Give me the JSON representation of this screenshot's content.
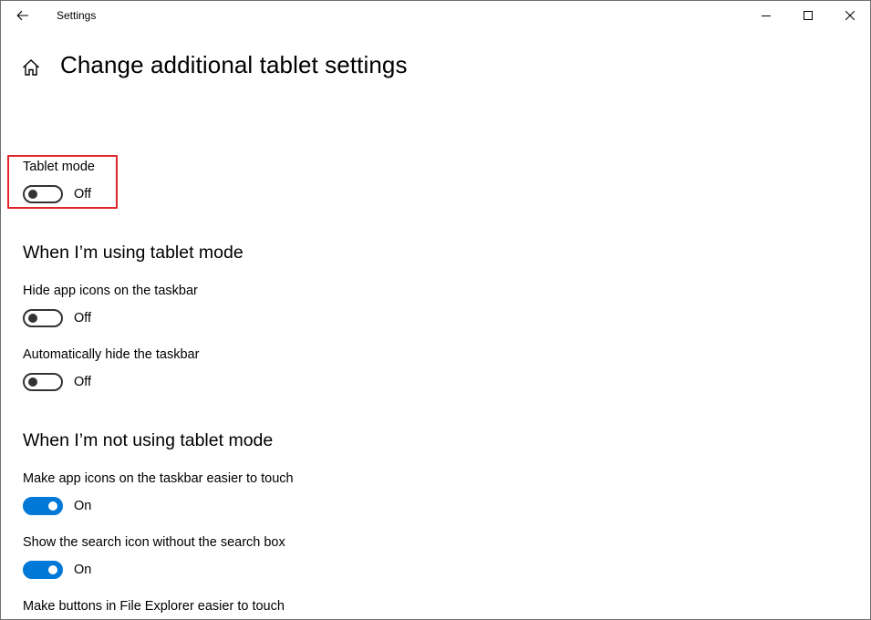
{
  "window": {
    "title": "Settings"
  },
  "page": {
    "title": "Change additional tablet settings"
  },
  "tablet_mode": {
    "label": "Tablet mode",
    "state": "Off"
  },
  "using_section": {
    "heading": "When I’m using tablet mode",
    "items": [
      {
        "label": "Hide app icons on the taskbar",
        "state": "Off"
      },
      {
        "label": "Automatically hide the taskbar",
        "state": "Off"
      }
    ]
  },
  "not_using_section": {
    "heading": "When I’m not using tablet mode",
    "items": [
      {
        "label": "Make app icons on the taskbar easier to touch",
        "state": "On"
      },
      {
        "label": "Show the search icon without the search box",
        "state": "On"
      },
      {
        "label": "Make buttons in File Explorer easier to touch"
      }
    ]
  },
  "colors": {
    "accent": "#0078d7",
    "highlight": "#e0262b",
    "toggle_off": "#333333"
  },
  "icons": {
    "back": "back-arrow-icon",
    "home": "home-icon",
    "minimize": "minimize-icon",
    "maximize": "maximize-icon",
    "close": "close-icon"
  }
}
